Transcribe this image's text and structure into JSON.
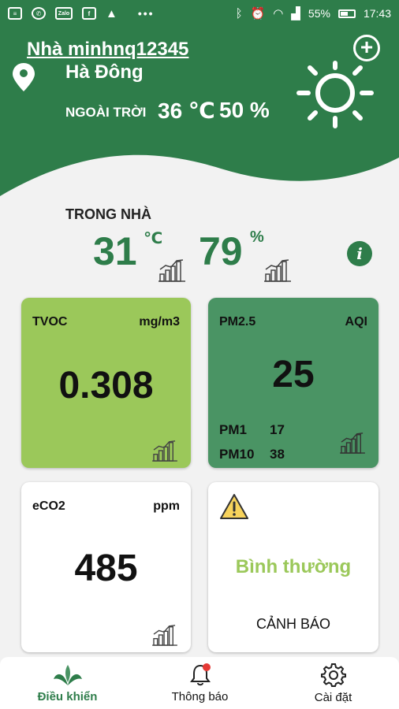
{
  "status_bar": {
    "left_icons": [
      "news-icon",
      "whatsapp-icon",
      "zalo-icon",
      "facebook-icon",
      "drive-icon"
    ],
    "zalo_text": "Zalo",
    "dots": "•••",
    "battery": "55%",
    "time": "17:43"
  },
  "header": {
    "home_name": "Nhà minhnq12345",
    "location": "Hà Đông",
    "outdoor_label": "NGOÀI TRỜI",
    "outdoor_temp": "36 ℃",
    "outdoor_humidity": "50 %",
    "weather_icon": "sun-icon"
  },
  "indoor": {
    "label": "TRONG NHÀ",
    "temp_value": "31",
    "temp_unit": "℃",
    "humidity_value": "79",
    "humidity_unit": "%",
    "info": "i"
  },
  "cards": {
    "tvoc": {
      "title": "TVOC",
      "unit": "mg/m3",
      "value": "0.308"
    },
    "pm": {
      "title": "PM2.5",
      "unit": "AQI",
      "value": "25",
      "pm1_label": "PM1",
      "pm1_value": "17",
      "pm10_label": "PM10",
      "pm10_value": "38"
    },
    "eco2": {
      "title": "eCO2",
      "unit": "ppm",
      "value": "485"
    },
    "warning": {
      "status": "Bình thường",
      "label": "CẢNH BÁO"
    }
  },
  "colors": {
    "brand_green": "#2e7d4a",
    "light_green": "#9bc85a",
    "mid_green": "#4a9464"
  },
  "nav": {
    "control": "Điều khiển",
    "notifications": "Thông báo",
    "settings": "Cài đặt"
  }
}
